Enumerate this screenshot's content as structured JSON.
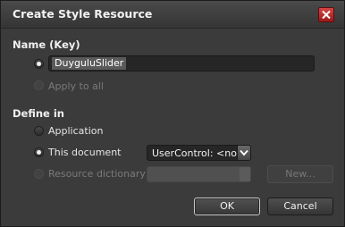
{
  "dialog": {
    "title": "Create Style Resource"
  },
  "name_section": {
    "label": "Name (Key)",
    "key_value": "DuyguluSlider",
    "apply_to_all_label": "Apply to all"
  },
  "define_section": {
    "label": "Define in",
    "application_label": "Application",
    "this_document_label": "This document",
    "this_document_selected": "UserControl: <no name>",
    "resource_dictionary_label": "Resource dictionary",
    "new_button_label": "New..."
  },
  "buttons": {
    "ok_label": "OK",
    "cancel_label": "Cancel"
  },
  "colors": {
    "background": "#3b3b3b",
    "close_button": "#c62828"
  },
  "icons": {
    "close": "close-icon",
    "dropdown": "chevron-down-icon"
  }
}
